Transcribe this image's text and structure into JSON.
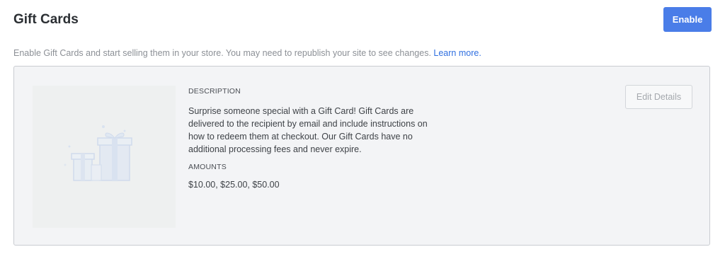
{
  "header": {
    "title": "Gift Cards",
    "enable_label": "Enable"
  },
  "intro": {
    "text": "Enable Gift Cards and start selling them in your store. You may need to republish your site to see changes. ",
    "link_label": "Learn more."
  },
  "gift_card": {
    "description_label": "DESCRIPTION",
    "description": "Surprise someone special with a Gift Card! Gift Cards are delivered to the recipient by email and include instructions on how to redeem them at checkout. Our Gift Cards have no additional processing fees and never expire.",
    "amounts_label": "AMOUNTS",
    "amounts": "$10.00, $25.00, $50.00",
    "edit_label": "Edit Details",
    "image_icon": "gift-boxes-illustration"
  },
  "colors": {
    "accent": "#4a7de8",
    "link": "#2f6fe0",
    "card_background": "#f3f4f6"
  }
}
